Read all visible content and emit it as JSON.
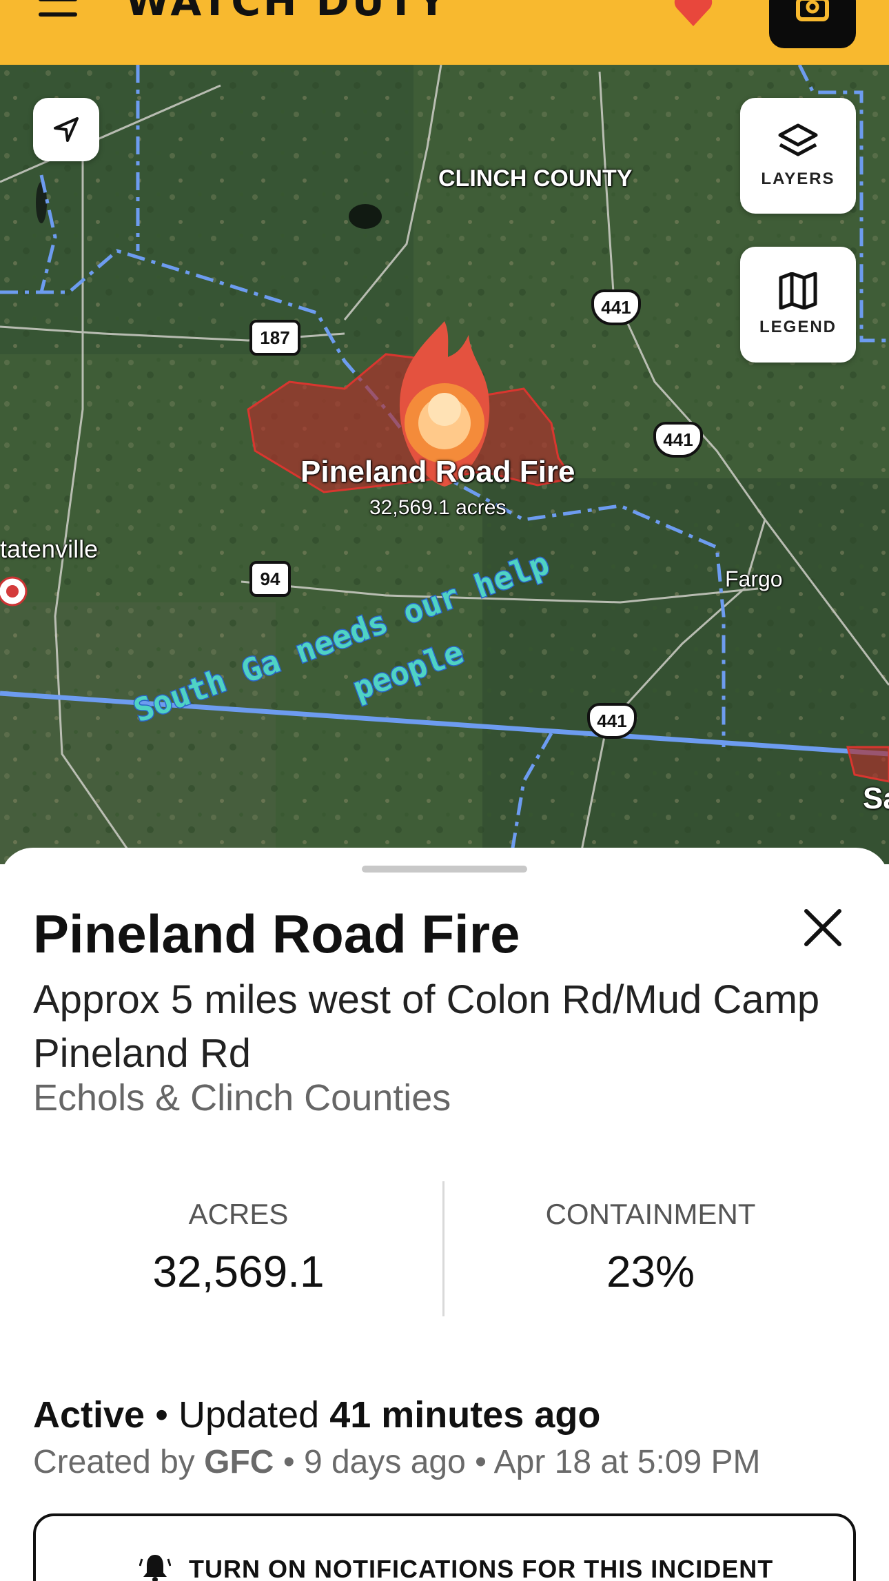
{
  "app": {
    "brand": "WATCH DUTY",
    "icons": {
      "menu": "hamburger-menu-icon",
      "favorite": "heart-icon",
      "camera": "camera-icon"
    },
    "colors": {
      "brand_yellow": "#f8b92f",
      "boundary_blue": "#6d9cf0"
    }
  },
  "map": {
    "county_label": "CLINCH COUNTY",
    "town_labels": [
      "tatenville",
      "Fargo",
      "Sa"
    ],
    "routes": [
      "187",
      "441",
      "441",
      "94",
      "441"
    ],
    "fire_label": "Pineland Road Fire",
    "fire_acres_label": "32,569.1 acres",
    "annotation_line1": "South Ga needs our help",
    "annotation_line2": "people",
    "buttons": {
      "layers": "LAYERS",
      "legend": "LEGEND"
    }
  },
  "incident": {
    "title": "Pineland Road Fire",
    "location": "Approx 5 miles west of Colon Rd/Mud Camp Pineland Rd",
    "region": "Echols & Clinch Counties",
    "stats": {
      "acres_label": "ACRES",
      "acres_value": "32,569.1",
      "containment_label": "CONTAINMENT",
      "containment_value": "23%"
    },
    "status": "Active",
    "updated_prefix": "Updated",
    "updated_value": "41 minutes ago",
    "created_prefix": "Created by",
    "created_by": "GFC",
    "created_ago": "9 days ago",
    "created_date": "Apr 18 at 5:09 PM",
    "notify_button": "TURN ON NOTIFICATIONS FOR THIS INCIDENT"
  }
}
